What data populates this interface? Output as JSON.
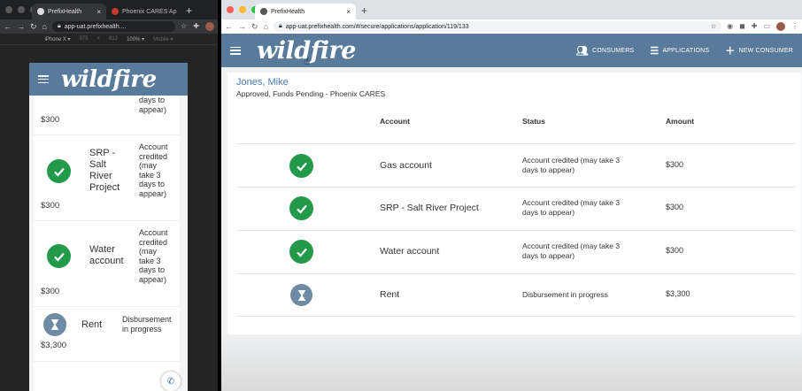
{
  "left_window": {
    "tabs": [
      {
        "label": "PrefixHealth",
        "close": "×"
      },
      {
        "label": "Phoenix CARES Ap",
        "close": "×"
      }
    ],
    "new_tab": "+",
    "url": "app-uat.prefixhealth....",
    "device_bar": {
      "device": "iPhone X ▾",
      "width": "375",
      "times": "×",
      "height": "812",
      "zoom": "100% ▾",
      "mode": "Mobile ▾"
    },
    "app": {
      "logo": "wildfire",
      "partial_status": [
        "days to",
        "appear)"
      ],
      "partial_amount": "$300",
      "rows": [
        {
          "name": [
            "SRP -",
            "Salt",
            "River",
            "Project"
          ],
          "status": [
            "Account",
            "credited",
            "(may",
            "take 3",
            "days to",
            "appear)"
          ],
          "amount": "$300",
          "state": "done"
        },
        {
          "name": [
            "Water",
            "account"
          ],
          "status": [
            "Account",
            "credited",
            "(may",
            "take 3",
            "days to",
            "appear)"
          ],
          "amount": "$300",
          "state": "done"
        },
        {
          "name": [
            "Rent"
          ],
          "status": [
            "Disbursement",
            "in progress"
          ],
          "amount": "$3,300",
          "state": "pending"
        }
      ]
    }
  },
  "right_window": {
    "tabs": [
      {
        "label": "PrefixHealth",
        "close": "×"
      }
    ],
    "new_tab": "+",
    "url": "app-uat.prefixhealth.com/#/secure/applications/application/119/133",
    "app": {
      "logo": "wildfire",
      "nav": [
        {
          "label": "CONSUMERS",
          "icon": "users-icon"
        },
        {
          "label": "APPLICATIONS",
          "icon": "list-icon"
        },
        {
          "label": "NEW CONSUMER",
          "icon": "plus-icon"
        }
      ],
      "consumer_name": "Jones, Mike",
      "application_status": "Approved, Funds Pending - Phoenix CARES",
      "table": {
        "headers": {
          "account": "Account",
          "status": "Status",
          "amount": "Amount"
        },
        "rows": [
          {
            "account": "Gas account",
            "status": [
              "Account credited (may take 3",
              "days to appear)"
            ],
            "amount": "$300",
            "state": "done"
          },
          {
            "account": "SRP - Salt River Project",
            "status": [
              "Account credited (may take 3",
              "days to appear)"
            ],
            "amount": "$300",
            "state": "done"
          },
          {
            "account": "Water account",
            "status": [
              "Account credited (may take 3",
              "days to appear)"
            ],
            "amount": "$300",
            "state": "done"
          },
          {
            "account": "Rent",
            "status": [
              "Disbursement in progress"
            ],
            "amount": "$3,300",
            "state": "pending"
          }
        ]
      }
    }
  },
  "colors": {
    "brand": "#587b9b",
    "success": "#23994a",
    "pending": "#6f8ba3",
    "link": "#4a7fb0"
  }
}
